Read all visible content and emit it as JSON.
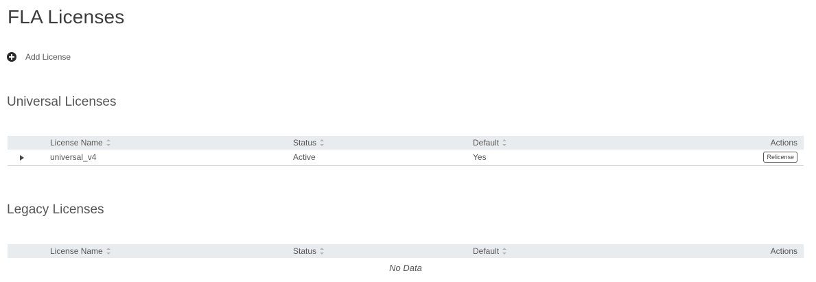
{
  "page": {
    "title": "FLA Licenses"
  },
  "toolbar": {
    "add_license_label": "Add License",
    "add_icon": "plus-circle-icon"
  },
  "universal": {
    "title": "Universal Licenses",
    "columns": {
      "name": "License Name",
      "status": "Status",
      "default": "Default",
      "actions": "Actions"
    },
    "rows": [
      {
        "name": "universal_v4",
        "status": "Active",
        "default": "Yes",
        "action_label": "Relicense"
      }
    ]
  },
  "legacy": {
    "title": "Legacy Licenses",
    "columns": {
      "name": "License Name",
      "status": "Status",
      "default": "Default",
      "actions": "Actions"
    },
    "rows": [],
    "empty_text": "No Data"
  }
}
